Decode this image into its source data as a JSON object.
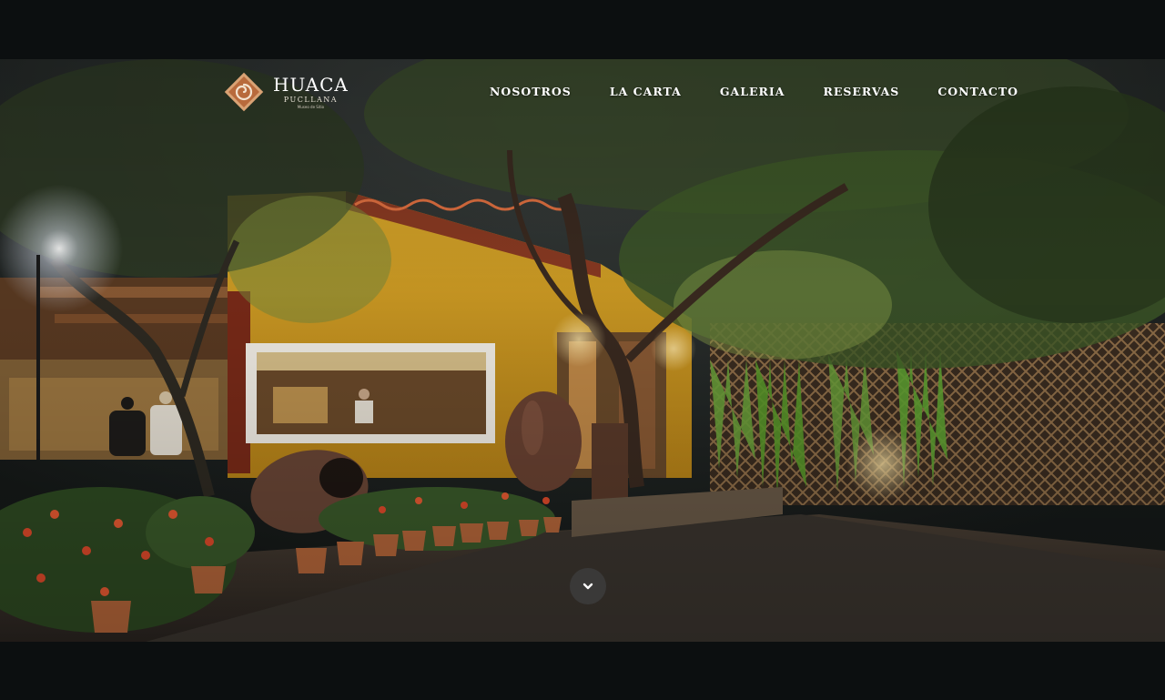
{
  "brand": {
    "name": "HUACA",
    "subtitle": "PUCLLANA",
    "tagline": "Museo de Sitio"
  },
  "nav": {
    "items": [
      {
        "label": "NOSOTROS"
      },
      {
        "label": "LA CARTA"
      },
      {
        "label": "GALERIA"
      },
      {
        "label": "RESERVAS"
      },
      {
        "label": "CONTACTO"
      }
    ]
  },
  "hero": {
    "image_icon": "restaurant-courtyard-night-photo",
    "scroll_icon": "chevron-down-icon"
  },
  "colors": {
    "page_background": "#0c0f10",
    "nav_text": "#ffffff",
    "logo_accent": "#b86a3c",
    "scroll_button": "#3c3c3c"
  }
}
